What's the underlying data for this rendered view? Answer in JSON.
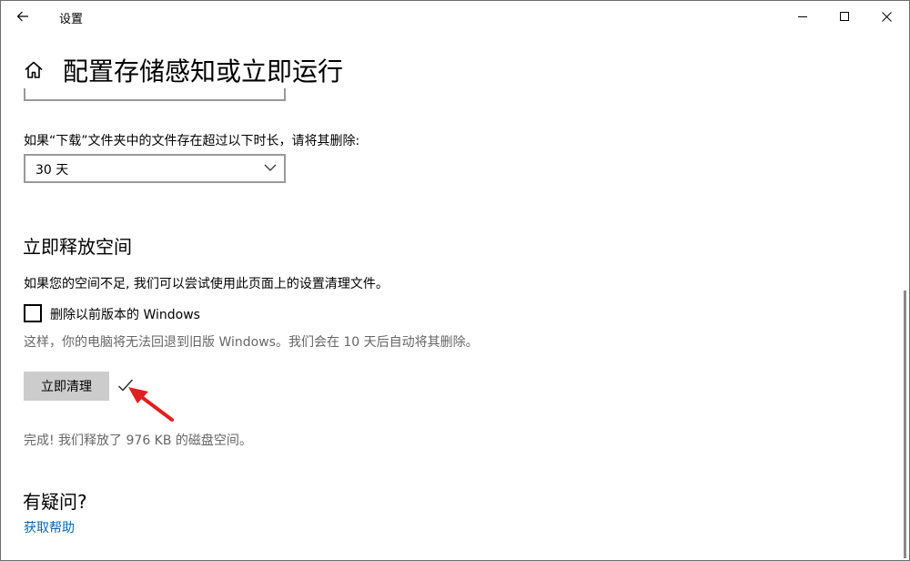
{
  "window": {
    "app_title": "设置"
  },
  "header": {
    "page_title": "配置存储感知或立即运行"
  },
  "downloads": {
    "label": "如果“下载”文件夹中的文件存在超过以下时长，请将其删除:",
    "selected_value": "30 天"
  },
  "free_space": {
    "section_title": "立即释放空间",
    "description": "如果您的空间不足, 我们可以尝试使用此页面上的设置清理文件。",
    "checkbox_label": "删除以前版本的 Windows",
    "checkbox_checked": false,
    "checkbox_hint": "这样，你的电脑将无法回退到旧版 Windows。我们会在 10 天后自动将其删除。",
    "clean_button_label": "立即清理",
    "result_text": "完成! 我们释放了 976 KB 的磁盘空间。"
  },
  "help": {
    "section_title": "有疑问?",
    "link_label": "获取帮助"
  },
  "colors": {
    "link": "#0067b8",
    "button_bg": "#cccccc",
    "arrow": "#e02020",
    "hint_text": "#666666"
  },
  "icons": {
    "back": "back-arrow-icon",
    "home": "home-icon",
    "minimize": "minimize-icon",
    "maximize": "maximize-icon",
    "close": "close-icon",
    "dropdown": "chevron-down-icon",
    "done": "checkmark-icon",
    "annotation": "red-arrow-icon"
  }
}
